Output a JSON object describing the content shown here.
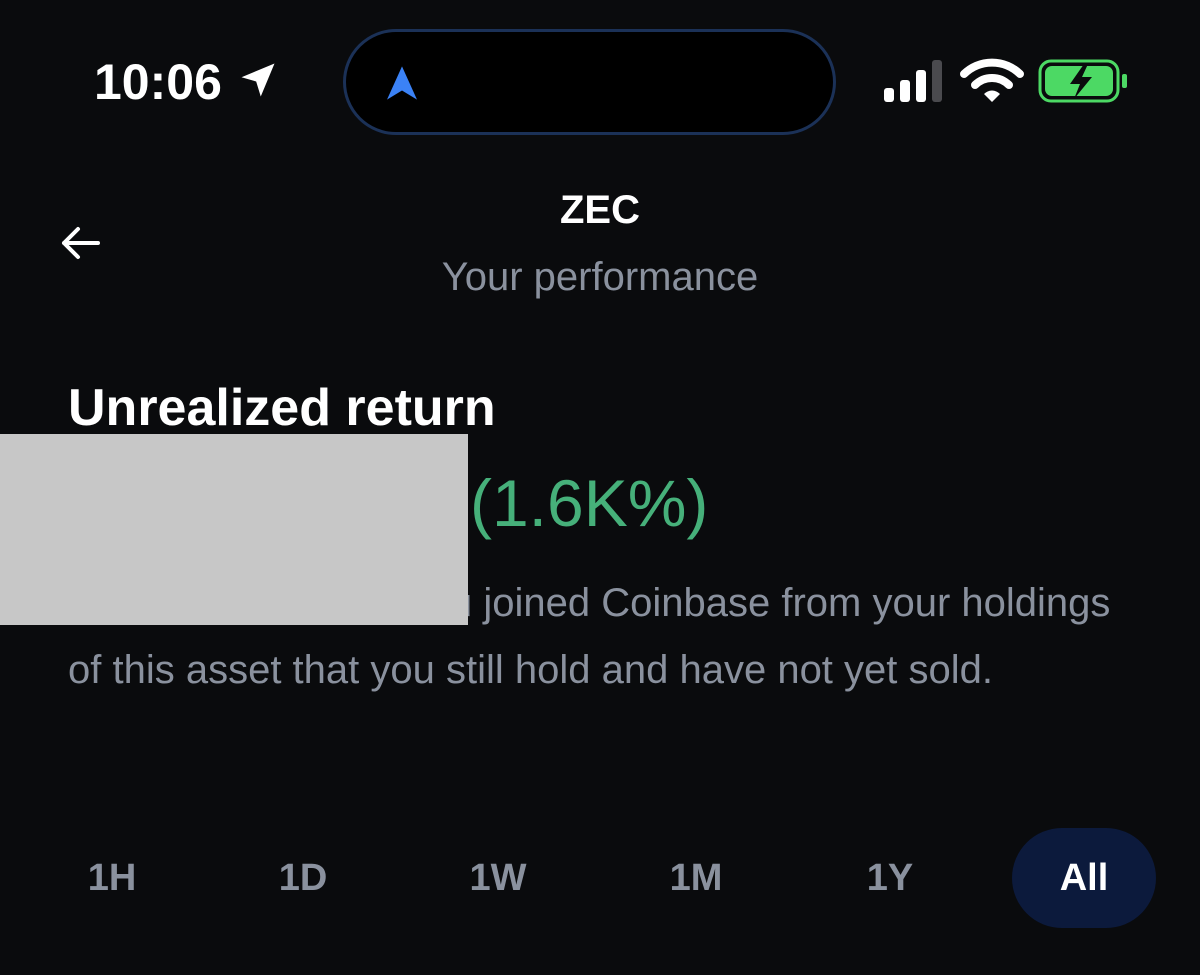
{
  "status_bar": {
    "time": "10:06",
    "icons": [
      "location-arrow-icon",
      "navigation-arrow-icon",
      "cellular-signal-icon",
      "wifi-icon",
      "battery-charging-icon"
    ],
    "accent_color": "#3b82f6",
    "battery_color": "#4cd964"
  },
  "header": {
    "title": "ZEC",
    "subtitle": "Your performance",
    "back_icon": "arrow-left-icon"
  },
  "content": {
    "heading": "Unrealized return",
    "return_value": "(1.6K%)",
    "return_color": "#46b07a",
    "description": "u joined Coinbase from your holdings of this asset that you still hold and have not yet sold."
  },
  "range_selector": {
    "tabs": [
      "1H",
      "1D",
      "1W",
      "1M",
      "1Y",
      "All"
    ],
    "selected": "All"
  }
}
